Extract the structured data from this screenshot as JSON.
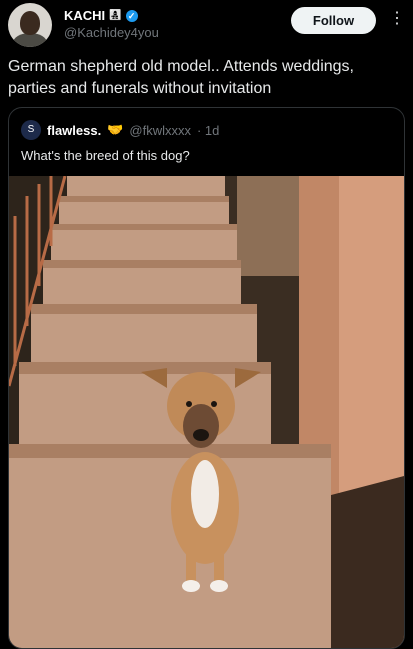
{
  "author": {
    "display_name": "KACHI",
    "emoji": "👩‍👧‍👦",
    "handle": "@Kachidey4you"
  },
  "follow_label": "Follow",
  "more_icon": "⋮",
  "post_text": "German shepherd old model.. Attends weddings, parties and funerals without invitation",
  "quoted": {
    "display_name": "flawless.",
    "emoji": "🤝",
    "handle": "@fkwlxxxx",
    "time": "· 1d",
    "text": "What's the breed of this dog?"
  },
  "colors": {
    "accent": "#1d9bf0",
    "background": "#000000"
  }
}
